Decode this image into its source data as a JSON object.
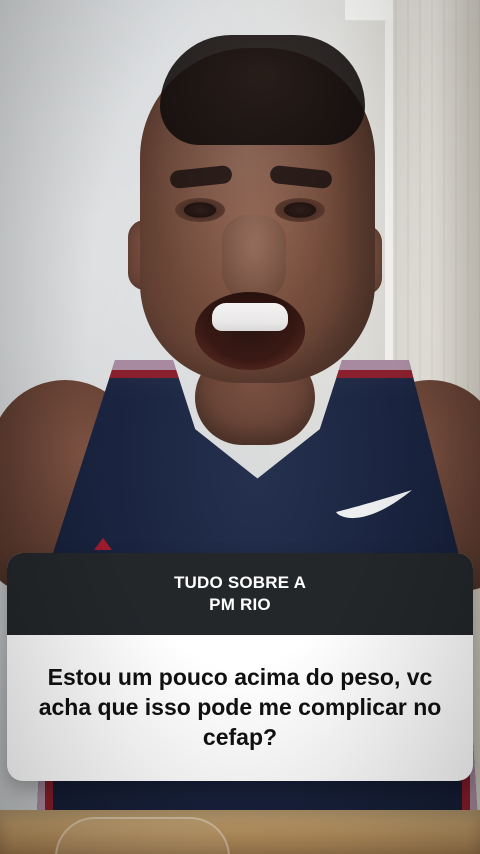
{
  "question_card": {
    "header_text": "TUDO SOBRE A\nPM RIO",
    "question_text": "Estou um pouco acima do peso, vc acha que isso pode me complicar no cefap?"
  },
  "colors": {
    "card_header_bg": "#23272a",
    "card_body_bg": "#ffffff",
    "card_text_dark": "#111111",
    "card_text_light": "#ffffff"
  },
  "icons": {
    "brand_logo": "swoosh-logo"
  }
}
